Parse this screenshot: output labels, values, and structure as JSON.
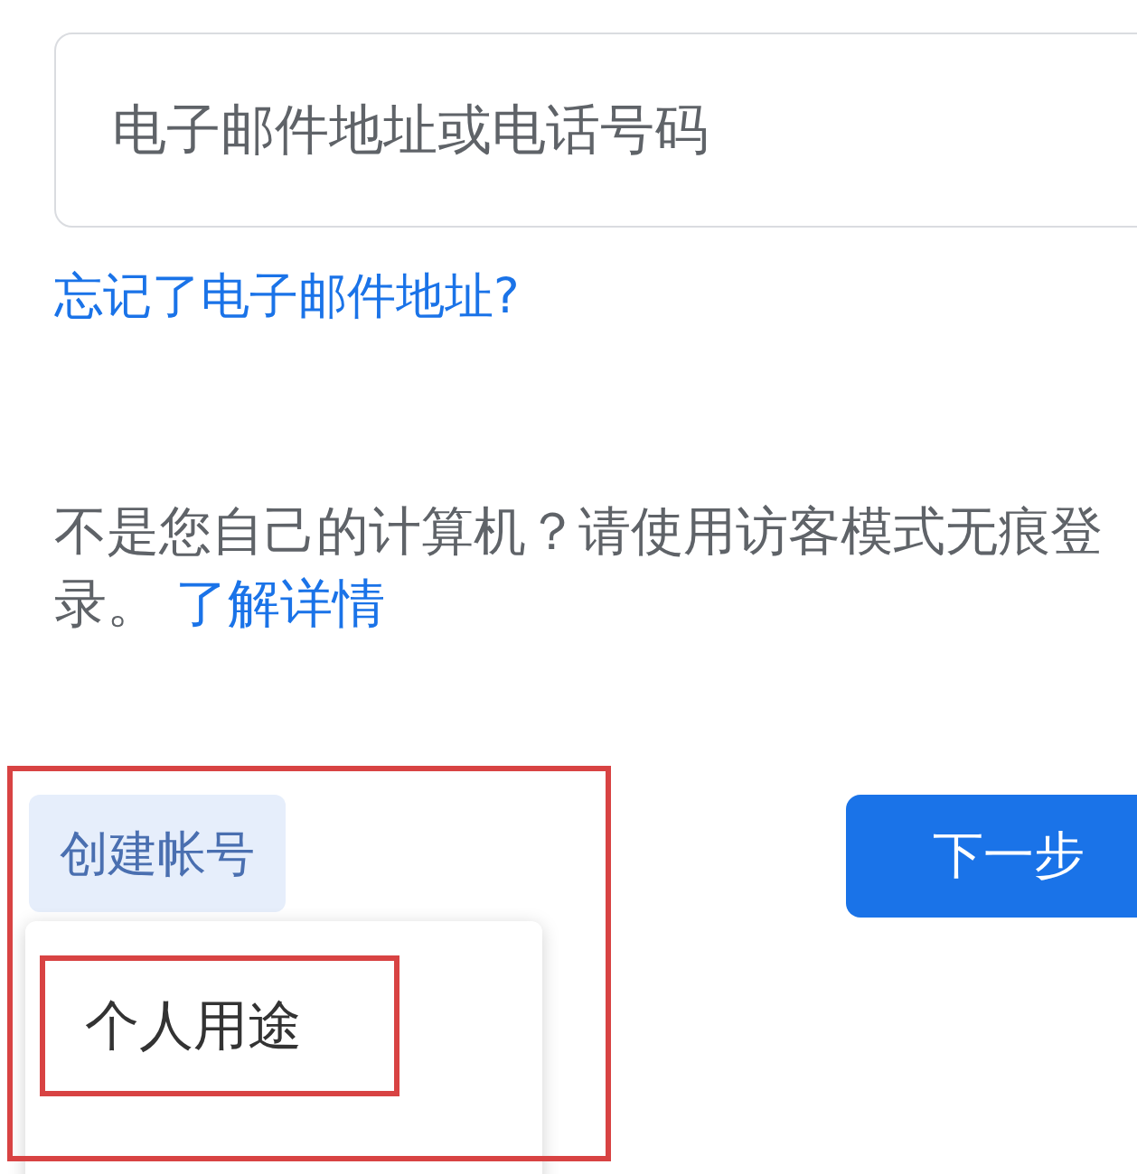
{
  "email_field": {
    "placeholder": "电子邮件地址或电话号码"
  },
  "forgot_link": "忘记了电子邮件地址?",
  "guest_notice": {
    "text": "不是您自己的计算机？请使用访客模式无痕登录。",
    "link": "了解详情"
  },
  "create_account": {
    "label": "创建帐号",
    "highlighted": true,
    "expanded": true
  },
  "create_menu": [
    {
      "label": "个人用途",
      "highlighted": true
    }
  ],
  "next_button": "下一步"
}
